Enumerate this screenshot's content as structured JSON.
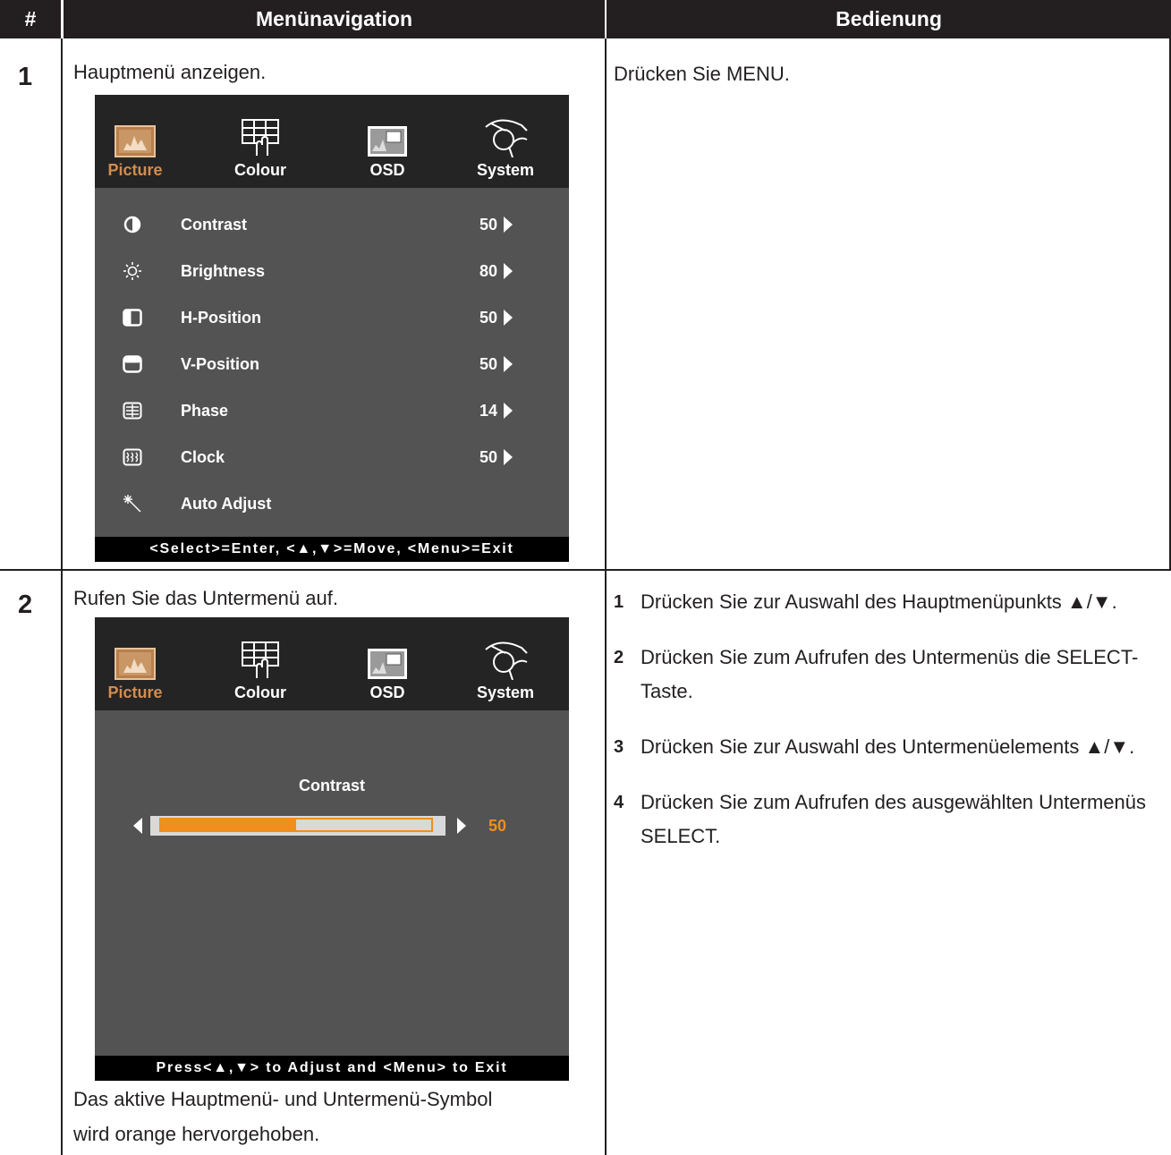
{
  "header": {
    "num": "#",
    "nav": "Menünavigation",
    "op": "Bedienung"
  },
  "row1": {
    "num": "1",
    "nav_text": "Hauptmenü anzeigen.",
    "op_text": "Drücken Sie MENU.",
    "osd": {
      "tabs": [
        {
          "label": "Picture",
          "icon": "picture-icon",
          "active": true
        },
        {
          "label": "Colour",
          "icon": "colour-icon",
          "active": false
        },
        {
          "label": "OSD",
          "icon": "osd-icon",
          "active": false
        },
        {
          "label": "System",
          "icon": "system-icon",
          "active": false
        }
      ],
      "items": [
        {
          "label": "Contrast",
          "value": "50",
          "icon": "contrast-icon"
        },
        {
          "label": "Brightness",
          "value": "80",
          "icon": "brightness-icon"
        },
        {
          "label": "H-Position",
          "value": "50",
          "icon": "h-position-icon"
        },
        {
          "label": "V-Position",
          "value": "50",
          "icon": "v-position-icon"
        },
        {
          "label": "Phase",
          "value": "14",
          "icon": "phase-icon"
        },
        {
          "label": "Clock",
          "value": "50",
          "icon": "clock-icon"
        },
        {
          "label": "Auto Adjust",
          "value": "",
          "icon": "auto-adjust-icon"
        }
      ],
      "footer": "<Select>=Enter, <▲,▼>=Move, <Menu>=Exit"
    }
  },
  "row2": {
    "num": "2",
    "nav_text": "Rufen Sie das Untermenü auf.",
    "osd": {
      "tabs": [
        {
          "label": "Picture",
          "active": true
        },
        {
          "label": "Colour",
          "active": false
        },
        {
          "label": "OSD",
          "active": false
        },
        {
          "label": "System",
          "active": false
        }
      ],
      "sub_label": "Contrast",
      "sub_value": "50",
      "slider_level": 0.5,
      "footer": "Press<▲,▼> to Adjust and <Menu> to Exit"
    },
    "note_line1": "Das aktive Hauptmenü- und Untermenü-Symbol",
    "note_line2": "wird orange hervorgehoben.",
    "steps": [
      {
        "num": "1",
        "text": "Drücken Sie zur Auswahl des Hauptmenüpunkts ▲/▼."
      },
      {
        "num": "2",
        "text": "Drücken Sie zum Aufrufen des Untermenüs die SELECT-Taste."
      },
      {
        "num": "3",
        "text": "Drücken Sie zur Auswahl des Untermenüelements ▲/▼."
      },
      {
        "num": "4",
        "text": "Drücken Sie zum Aufrufen des ausgewählten Untermenüs SELECT."
      }
    ]
  },
  "colors": {
    "header_bg": "#231f20",
    "osd_bg": "#535353",
    "osd_top": "#242424",
    "accent": "#f08e1e",
    "active_tab": "#d38c4f"
  }
}
